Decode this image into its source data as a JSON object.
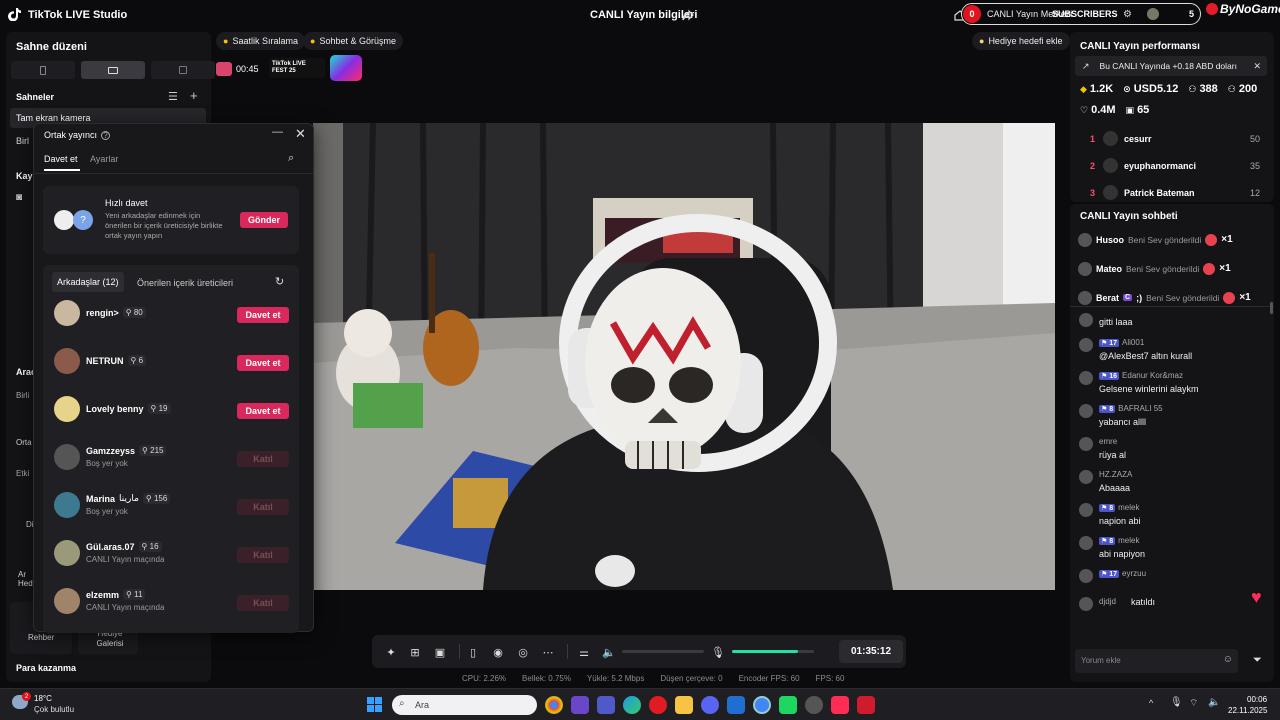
{
  "window": {
    "app_title": "TikTok LIVE Studio",
    "live_info": "CANLI Yayın bilgileri",
    "live_center": "CANLI Yayın Merkezi",
    "subscribers": "SUBSCRIBERS",
    "sub_count": "0",
    "sub_count_right": "5",
    "brand": "ByNoGame"
  },
  "sidebar": {
    "scene_layout": "Sahne düzeni",
    "scenes_title": "Sahneler",
    "scene_items": [
      "Tam ekran kamera",
      "Birl"
    ],
    "section_kay": "Kay",
    "section_arac": "Arac",
    "label_birli": "Birli",
    "label_orta": "Orta",
    "label_etki": "Etki",
    "label_di": "Di",
    "label_an_hedi": "Ar Hedi",
    "rehber": "Rehber",
    "hediye_galerisi": "Hediye Galerisi",
    "para_kazanma": "Para kazanma"
  },
  "top_chips": {
    "hourly": "Saatlik Sıralama",
    "chat": "Sohbet & Görüşme",
    "gift_goal": "Hediye hedefi ekle",
    "timer": "00:45",
    "fest": "TikTok LIVE FEST 25"
  },
  "cohost": {
    "title": "Ortak yayıncı",
    "tabs": [
      "Davet et",
      "Ayarlar"
    ],
    "quick_invite_title": "Hızlı davet",
    "quick_invite_desc": "Yeni arkadaşlar edinmek için önerilen bir içerik üreticisiyle birlikte ortak yayın yapın",
    "send_label": "Gönder",
    "friends_tab": "Arkadaşlar (12)",
    "suggested_tab": "Önerilen içerik üreticileri",
    "friends": [
      {
        "name": "rengin>",
        "count": "80",
        "sub": "",
        "action": "Davet et",
        "enabled": true,
        "color": "#c9b7a0"
      },
      {
        "name": "NETRUN",
        "count": "6",
        "sub": "",
        "action": "Davet et",
        "enabled": true,
        "color": "#8a5a4a"
      },
      {
        "name": "Lovely benny",
        "count": "19",
        "sub": "",
        "action": "Davet et",
        "enabled": true,
        "color": "#e6d48a"
      },
      {
        "name": "Gamzzeyss",
        "count": "215",
        "sub": "Boş yer yok",
        "action": "Katıl",
        "enabled": false,
        "color": "#555"
      },
      {
        "name": "Marina",
        "name_extra": "مارينا",
        "count": "156",
        "sub": "Boş yer yok",
        "action": "Katıl",
        "enabled": false,
        "color": "#3d7a8f"
      },
      {
        "name": "Gül.aras.07",
        "count": "16",
        "sub": "CANLI Yayın maçında",
        "action": "Katıl",
        "enabled": false,
        "color": "#9a9a7a"
      },
      {
        "name": "elzemm",
        "count": "11",
        "sub": "CANLI Yayın maçında",
        "action": "Katıl",
        "enabled": false,
        "color": "#a0846a"
      }
    ]
  },
  "performance": {
    "title": "CANLI Yayın performansı",
    "earning_banner": "Bu CANLI Yayında +0.18 ABD doları",
    "stats": {
      "diamonds": "1.2K",
      "usd": "USD5.12",
      "viewers": "388",
      "followers": "200",
      "likes": "0.4M",
      "gifts": "65"
    },
    "ranking": [
      {
        "rank": "1",
        "name": "cesurr",
        "score": "50"
      },
      {
        "rank": "2",
        "name": "eyuphanormanci",
        "score": "35"
      },
      {
        "rank": "3",
        "name": "Patrick Bateman",
        "score": "12"
      }
    ]
  },
  "chat": {
    "title": "CANLI Yayın sohbeti",
    "gifts": [
      {
        "name": "Husoo",
        "text": "Beni Sev gönderildi",
        "qty": "×1"
      },
      {
        "name": "Mateo",
        "text": "Beni Sev gönderildi",
        "qty": "×1"
      },
      {
        "name": "Berat",
        "badge": "C",
        "name_suffix": ";)",
        "text": "Beni Sev gönderildi",
        "qty": "×1"
      }
    ],
    "messages": [
      {
        "user": "",
        "level": "",
        "msg": "gitti laaa"
      },
      {
        "user": "Ali001",
        "level": "17",
        "msg": "@AlexBest7 altın kurall"
      },
      {
        "user": "Edanur Kor&maz",
        "level": "16",
        "msg": "Gelsene winlerini alaykm"
      },
      {
        "user": "BAFRALI 55",
        "level": "8",
        "msg": "yabancı allll"
      },
      {
        "user": "emre",
        "level": "",
        "msg": "rüya al"
      },
      {
        "user": "HZ.ZAZA",
        "level": "",
        "msg": "Abaaaa"
      },
      {
        "user": "melek",
        "level": "8",
        "msg": "napion abi"
      },
      {
        "user": "melek",
        "level": "8",
        "msg": "abi napiyon"
      },
      {
        "user": "eyrzuu",
        "level": "17",
        "msg": ""
      },
      {
        "user": "djdjd",
        "level": "",
        "msg": "katıldı"
      }
    ],
    "comment_placeholder": "Yorum ekle"
  },
  "controls": {
    "timer": "01:35:12",
    "volume_level": 0.0,
    "mic_level": 0.8
  },
  "status": {
    "cpu": "CPU: 2.26%",
    "memory": "Bellek: 0.75%",
    "upload": "Yükle: 5.2 Mbps",
    "dropped": "Düşen çerçeve: 0",
    "encoder_fps": "Encoder FPS: 60",
    "fps": "FPS: 60"
  },
  "taskbar": {
    "weather_temp": "18°C",
    "weather_desc": "Çok bulutlu",
    "search": "Ara",
    "time": "00:06",
    "date": "22.11.2025",
    "weather_badge": "2"
  }
}
